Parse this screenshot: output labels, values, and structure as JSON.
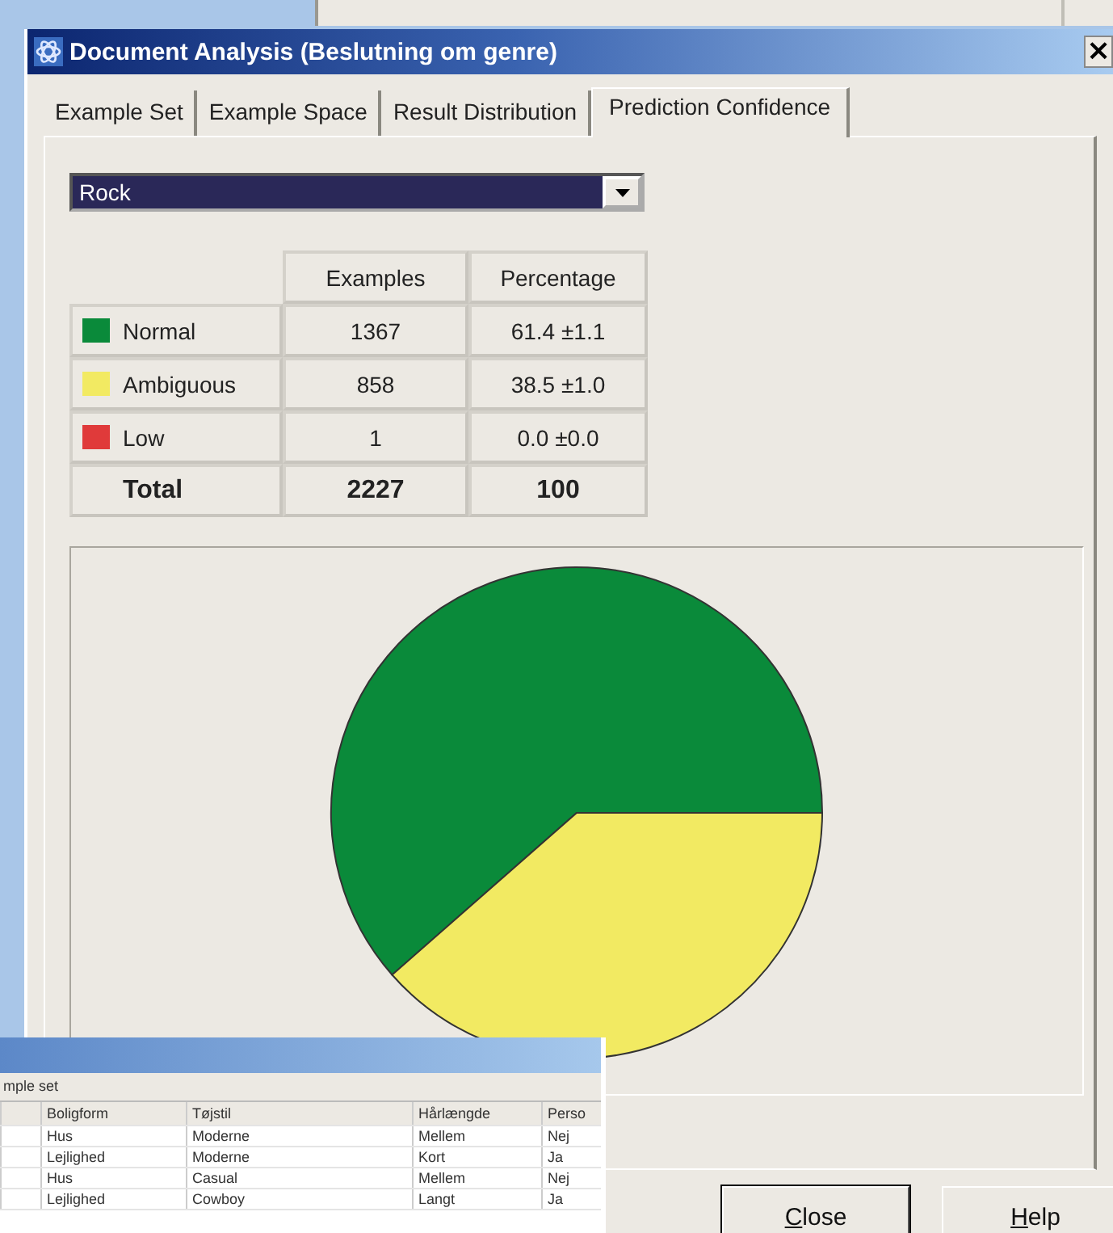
{
  "window": {
    "title": "Document Analysis (Beslutning om genre)",
    "close_glyph": "×"
  },
  "tabs": [
    {
      "label": "Example Set",
      "selected": false
    },
    {
      "label": "Example Space",
      "selected": false
    },
    {
      "label": "Result Distribution",
      "selected": false
    },
    {
      "label": "Prediction Confidence",
      "selected": true
    }
  ],
  "dropdown": {
    "value": "Rock"
  },
  "table": {
    "columns": [
      "Examples",
      "Percentage"
    ],
    "rows": [
      {
        "kind": "category",
        "label": "Normal",
        "color": "#0a8a3a",
        "examples": "1367",
        "percentage": "61.4 ±1.1"
      },
      {
        "kind": "category",
        "label": "Ambiguous",
        "color": "#f2ea62",
        "examples": "858",
        "percentage": "38.5 ±1.0"
      },
      {
        "kind": "category",
        "label": "Low",
        "color": "#e03a3a",
        "examples": "1",
        "percentage": "0.0 ±0.0"
      },
      {
        "kind": "total",
        "label": "Total",
        "examples": "2227",
        "percentage": "100"
      }
    ]
  },
  "chart_data": {
    "type": "pie",
    "values": [
      61.4,
      38.5
    ],
    "colors": [
      "#0a8a3a",
      "#f2ea62"
    ]
  },
  "buttons": [
    {
      "label": "Close",
      "default": true
    },
    {
      "label": "Help",
      "default": false
    }
  ],
  "background_window": {
    "caption": "mple set",
    "columns": [
      "Boligform",
      "Tøjstil",
      "Hårlængde",
      "Perso"
    ],
    "rows": [
      [
        "Hus",
        "Moderne",
        "Mellem",
        "Nej"
      ],
      [
        "Lejlighed",
        "Moderne",
        "Kort",
        "Ja"
      ],
      [
        "Hus",
        "Casual",
        "Mellem",
        "Nej"
      ],
      [
        "Lejlighed",
        "Cowboy",
        "Langt",
        "Ja"
      ]
    ]
  }
}
